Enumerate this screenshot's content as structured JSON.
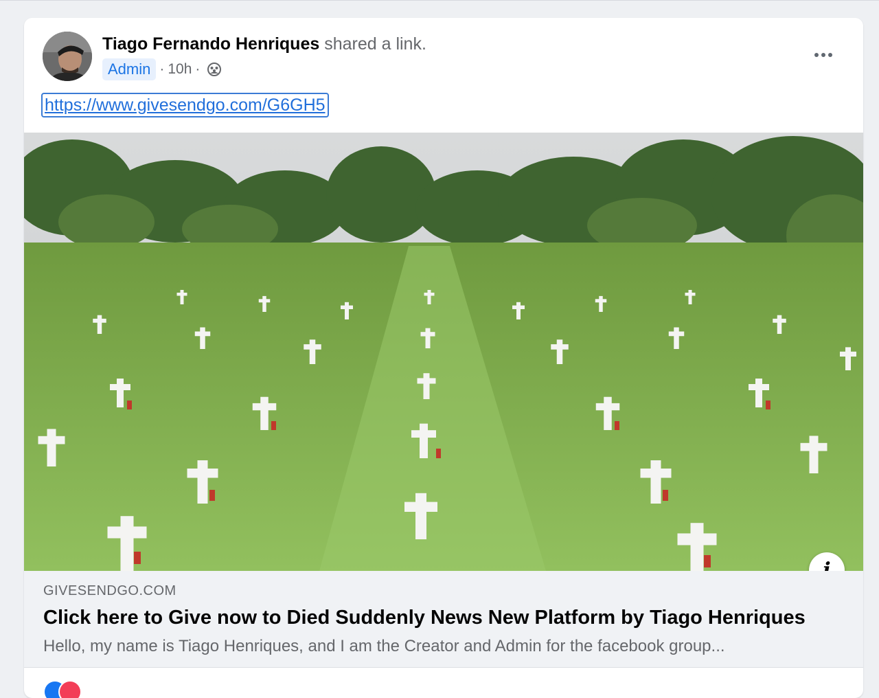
{
  "post": {
    "author_name": "Tiago Fernando Henriques",
    "action_text": "shared a link.",
    "role_badge": "Admin",
    "separator": "·",
    "time_ago": "10h",
    "audience_icon": "group-icon",
    "more_icon": "more-horizontal-icon",
    "link_text": "https://www.givesendgo.com/G6GH5"
  },
  "link_preview": {
    "domain": "GIVESENDGO.COM",
    "title": "Click here to Give now to Died Suddenly News New Platform by Tiago Henriques",
    "description": "Hello, my name is Tiago Henriques, and I am the Creator and Admin for the facebook group...",
    "info_icon": "info-icon",
    "info_glyph": "i"
  },
  "reactions": {
    "icons": [
      "like-reaction-icon",
      "love-reaction-icon"
    ]
  },
  "colors": {
    "link_blue": "#216fdb",
    "badge_bg": "#e7f0fd",
    "badge_text": "#1b74e4",
    "grass": "#8db85a",
    "like": "#1877f2",
    "love": "#f33e58"
  }
}
